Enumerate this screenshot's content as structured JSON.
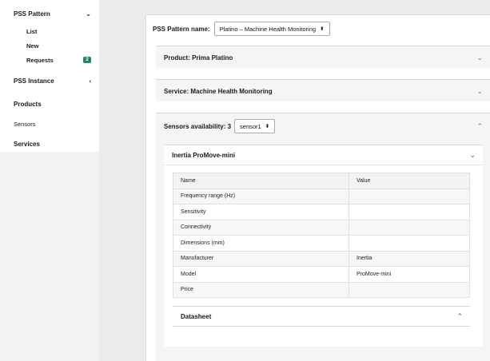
{
  "sidebar": {
    "pss_pattern": "PSS Pattern",
    "pss_pattern_chevron": "⌄",
    "sub": [
      {
        "label": "List"
      },
      {
        "label": "New"
      },
      {
        "label": "Requests",
        "badge": "2"
      }
    ],
    "pss_instance": "PSS Instance",
    "pss_instance_chevron": "‹",
    "products": "Products",
    "sensors": "Sensors",
    "services": "Services"
  },
  "main": {
    "pattern_label": "PSS Pattern name:",
    "pattern_value": "Platino – Machine Health Monitoring",
    "select_arrows": "⬍",
    "product_title": "Product: Prima Platino",
    "service_title": "Service: Machine Health Monitoring",
    "sensors_title": "Sensors availability: 3",
    "sensor_select": "sensor1",
    "sensor_card_title": "Inertia ProMove-mini",
    "table": {
      "headers": [
        "Name",
        "Value"
      ],
      "rows": [
        [
          "Frequency range (Hz)",
          ""
        ],
        [
          "Sensitivity",
          ""
        ],
        [
          "Connectivity",
          ""
        ],
        [
          "Dimensions (mm)",
          ""
        ],
        [
          "Manufacturer",
          "Inertia"
        ],
        [
          "Model",
          "ProMove-mini"
        ],
        [
          "Price",
          ""
        ]
      ]
    },
    "datasheet_title": "Datasheet",
    "chev_down": "⌄",
    "chev_up": "⌃"
  }
}
